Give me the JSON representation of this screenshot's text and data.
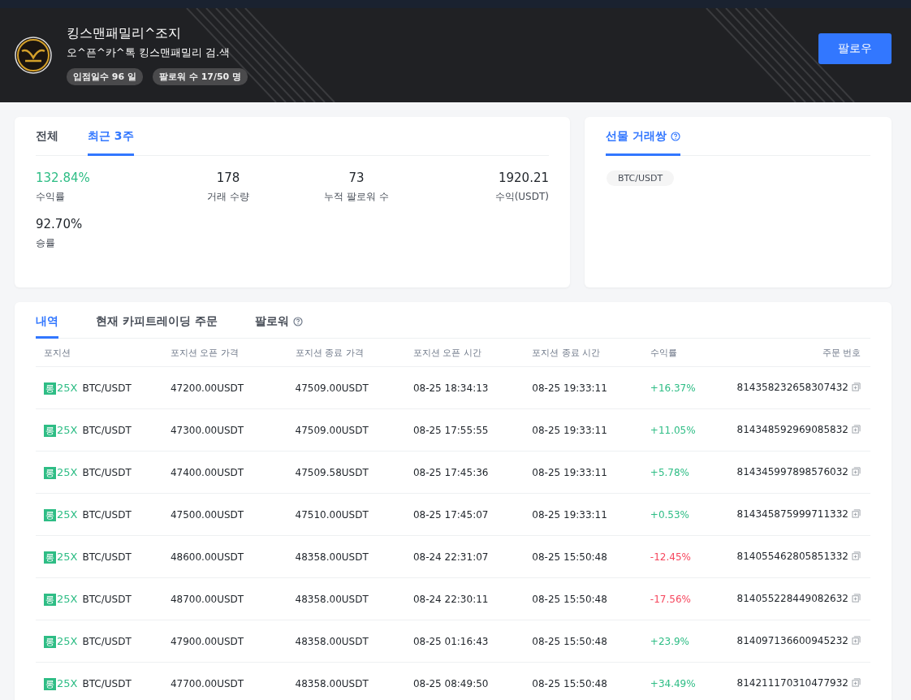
{
  "profile": {
    "name": "킹스맨패밀리^조지",
    "subtitle": "오^픈^카^톡 킹스맨패밀리 검.색",
    "badges": [
      "입점일수 96 일",
      "팔로워 수 17/50 명"
    ],
    "follow_button": "팔로우"
  },
  "stats": {
    "tabs": [
      {
        "label": "전체",
        "selected": false
      },
      {
        "label": "최근 3주",
        "selected": true
      }
    ],
    "items": [
      {
        "value": "132.84%",
        "label": "수익률",
        "color": "#2ebd85"
      },
      {
        "value": "178",
        "label": "거래 수량",
        "color": "#1e2329"
      },
      {
        "value": "73",
        "label": "누적 팔로워 수",
        "color": "#1e2329"
      },
      {
        "value": "1920.21",
        "label": "수익(USDT)",
        "color": "#1e2329"
      },
      {
        "value": "92.70%",
        "label": "승률",
        "color": "#1e2329"
      }
    ]
  },
  "pairs": {
    "tab": "선물 거래쌍",
    "items": [
      "BTC/USDT"
    ]
  },
  "orders": {
    "tabs": [
      {
        "label": "내역",
        "selected": true,
        "help": false
      },
      {
        "label": "현재 카피트레이딩 주문",
        "selected": false,
        "help": false
      },
      {
        "label": "팔로워",
        "selected": false,
        "help": true
      }
    ],
    "columns": [
      "포지션",
      "포지션 오픈 가격",
      "포지션 종료 가격",
      "포지션 오픈 시간",
      "포지션 종료 시간",
      "수익률",
      "주문 번호"
    ],
    "rows": [
      {
        "side": "롱",
        "leverage": "25X",
        "pair": "BTC/USDT",
        "open_price": "47200.00USDT",
        "close_price": "47509.00USDT",
        "open_time": "08-25 18:34:13",
        "close_time": "08-25 19:33:11",
        "profit": "+16.37%",
        "color": "#2ebd85",
        "order_no": "814358232658307432"
      },
      {
        "side": "롱",
        "leverage": "25X",
        "pair": "BTC/USDT",
        "open_price": "47300.00USDT",
        "close_price": "47509.00USDT",
        "open_time": "08-25 17:55:55",
        "close_time": "08-25 19:33:11",
        "profit": "+11.05%",
        "color": "#2ebd85",
        "order_no": "814348592969085832"
      },
      {
        "side": "롱",
        "leverage": "25X",
        "pair": "BTC/USDT",
        "open_price": "47400.00USDT",
        "close_price": "47509.58USDT",
        "open_time": "08-25 17:45:36",
        "close_time": "08-25 19:33:11",
        "profit": "+5.78%",
        "color": "#2ebd85",
        "order_no": "814345997898576032"
      },
      {
        "side": "롱",
        "leverage": "25X",
        "pair": "BTC/USDT",
        "open_price": "47500.00USDT",
        "close_price": "47510.00USDT",
        "open_time": "08-25 17:45:07",
        "close_time": "08-25 19:33:11",
        "profit": "+0.53%",
        "color": "#2ebd85",
        "order_no": "814345875999711332"
      },
      {
        "side": "롱",
        "leverage": "25X",
        "pair": "BTC/USDT",
        "open_price": "48600.00USDT",
        "close_price": "48358.00USDT",
        "open_time": "08-24 22:31:07",
        "close_time": "08-25 15:50:48",
        "profit": "-12.45%",
        "color": "#f6465d",
        "order_no": "814055462805851332"
      },
      {
        "side": "롱",
        "leverage": "25X",
        "pair": "BTC/USDT",
        "open_price": "48700.00USDT",
        "close_price": "48358.00USDT",
        "open_time": "08-24 22:30:11",
        "close_time": "08-25 15:50:48",
        "profit": "-17.56%",
        "color": "#f6465d",
        "order_no": "814055228449082632"
      },
      {
        "side": "롱",
        "leverage": "25X",
        "pair": "BTC/USDT",
        "open_price": "47900.00USDT",
        "close_price": "48358.00USDT",
        "open_time": "08-25 01:16:43",
        "close_time": "08-25 15:50:48",
        "profit": "+23.9%",
        "color": "#2ebd85",
        "order_no": "814097136600945232"
      },
      {
        "side": "롱",
        "leverage": "25X",
        "pair": "BTC/USDT",
        "open_price": "47700.00USDT",
        "close_price": "48358.00USDT",
        "open_time": "08-25 08:49:50",
        "close_time": "08-25 15:50:48",
        "profit": "+34.49%",
        "color": "#2ebd85",
        "order_no": "814211170310477932"
      }
    ]
  }
}
